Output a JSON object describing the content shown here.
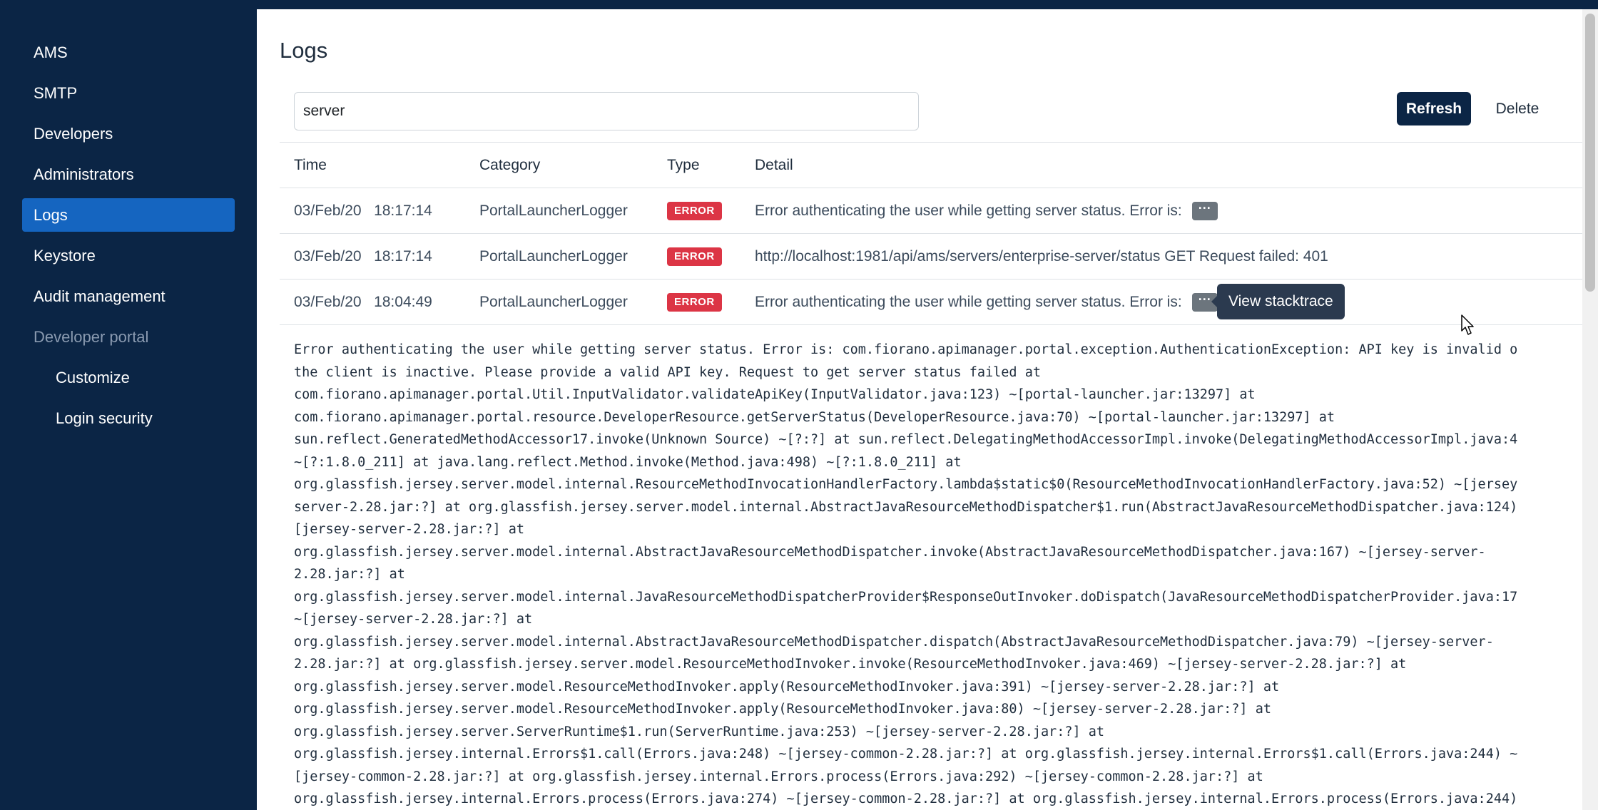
{
  "sidebar": {
    "items": [
      {
        "label": "AMS"
      },
      {
        "label": "SMTP"
      },
      {
        "label": "Developers"
      },
      {
        "label": "Administrators"
      },
      {
        "label": "Logs"
      },
      {
        "label": "Keystore"
      },
      {
        "label": "Audit management"
      },
      {
        "label": "Developer portal"
      },
      {
        "label": "Customize"
      },
      {
        "label": "Login security"
      }
    ]
  },
  "main": {
    "title": "Logs",
    "search": {
      "value": "server"
    },
    "refresh_label": "Refresh",
    "delete_label": "Delete",
    "columns": {
      "time": "Time",
      "category": "Category",
      "type": "Type",
      "detail": "Detail"
    },
    "rows": [
      {
        "time": "03/Feb/20   18:17:14",
        "category": "PortalLauncherLogger",
        "type": "ERROR",
        "detail": "Error authenticating the user while getting server status. Error is:"
      },
      {
        "time": "03/Feb/20   18:17:14",
        "category": "PortalLauncherLogger",
        "type": "ERROR",
        "detail": "http://localhost:1981/api/ams/servers/enterprise-server/status GET Request failed: 401"
      },
      {
        "time": "03/Feb/20   18:04:49",
        "category": "PortalLauncherLogger",
        "type": "ERROR",
        "detail": "Error authenticating the user while getting server status. Error is:"
      }
    ],
    "ellipsis_label": "···",
    "tooltip": "View stacktrace",
    "stacktrace_lines": [
      "Error authenticating the user while getting server status. Error is: com.fiorano.apimanager.portal.exception.AuthenticationException: API key is invalid o",
      "the client is inactive. Please provide a valid API key. Request to get server status failed at",
      "com.fiorano.apimanager.portal.Util.InputValidator.validateApiKey(InputValidator.java:123) ~[portal-launcher.jar:13297] at",
      "com.fiorano.apimanager.portal.resource.DeveloperResource.getServerStatus(DeveloperResource.java:70) ~[portal-launcher.jar:13297] at",
      "sun.reflect.GeneratedMethodAccessor17.invoke(Unknown Source) ~[?:?] at sun.reflect.DelegatingMethodAccessorImpl.invoke(DelegatingMethodAccessorImpl.java:4",
      "~[?:1.8.0_211] at java.lang.reflect.Method.invoke(Method.java:498) ~[?:1.8.0_211] at",
      "org.glassfish.jersey.server.model.internal.ResourceMethodInvocationHandlerFactory.lambda$static$0(ResourceMethodInvocationHandlerFactory.java:52) ~[jersey",
      "server-2.28.jar:?] at org.glassfish.jersey.server.model.internal.AbstractJavaResourceMethodDispatcher$1.run(AbstractJavaResourceMethodDispatcher.java:124)",
      "[jersey-server-2.28.jar:?] at",
      "org.glassfish.jersey.server.model.internal.AbstractJavaResourceMethodDispatcher.invoke(AbstractJavaResourceMethodDispatcher.java:167) ~[jersey-server-",
      "2.28.jar:?] at",
      "org.glassfish.jersey.server.model.internal.JavaResourceMethodDispatcherProvider$ResponseOutInvoker.doDispatch(JavaResourceMethodDispatcherProvider.java:17",
      "~[jersey-server-2.28.jar:?] at",
      "org.glassfish.jersey.server.model.internal.AbstractJavaResourceMethodDispatcher.dispatch(AbstractJavaResourceMethodDispatcher.java:79) ~[jersey-server-",
      "2.28.jar:?] at org.glassfish.jersey.server.model.ResourceMethodInvoker.invoke(ResourceMethodInvoker.java:469) ~[jersey-server-2.28.jar:?] at",
      "org.glassfish.jersey.server.model.ResourceMethodInvoker.apply(ResourceMethodInvoker.java:391) ~[jersey-server-2.28.jar:?] at",
      "org.glassfish.jersey.server.model.ResourceMethodInvoker.apply(ResourceMethodInvoker.java:80) ~[jersey-server-2.28.jar:?] at",
      "org.glassfish.jersey.server.ServerRuntime$1.run(ServerRuntime.java:253) ~[jersey-server-2.28.jar:?] at",
      "org.glassfish.jersey.internal.Errors$1.call(Errors.java:248) ~[jersey-common-2.28.jar:?] at org.glassfish.jersey.internal.Errors$1.call(Errors.java:244) ~",
      "[jersey-common-2.28.jar:?] at org.glassfish.jersey.internal.Errors.process(Errors.java:292) ~[jersey-common-2.28.jar:?] at",
      "org.glassfish.jersey.internal.Errors.process(Errors.java:274) ~[jersey-common-2.28.jar:?] at org.glassfish.jersey.internal.Errors.process(Errors.java:244)"
    ]
  },
  "colors": {
    "sidebar_bg": "#0b2545",
    "active_item": "#1565c0",
    "error_badge": "#dc3545",
    "muted_button": "#6c757d"
  },
  "icons": {
    "ellipsis": "more-horizontal-icon",
    "cursor": "mouse-pointer-icon"
  }
}
